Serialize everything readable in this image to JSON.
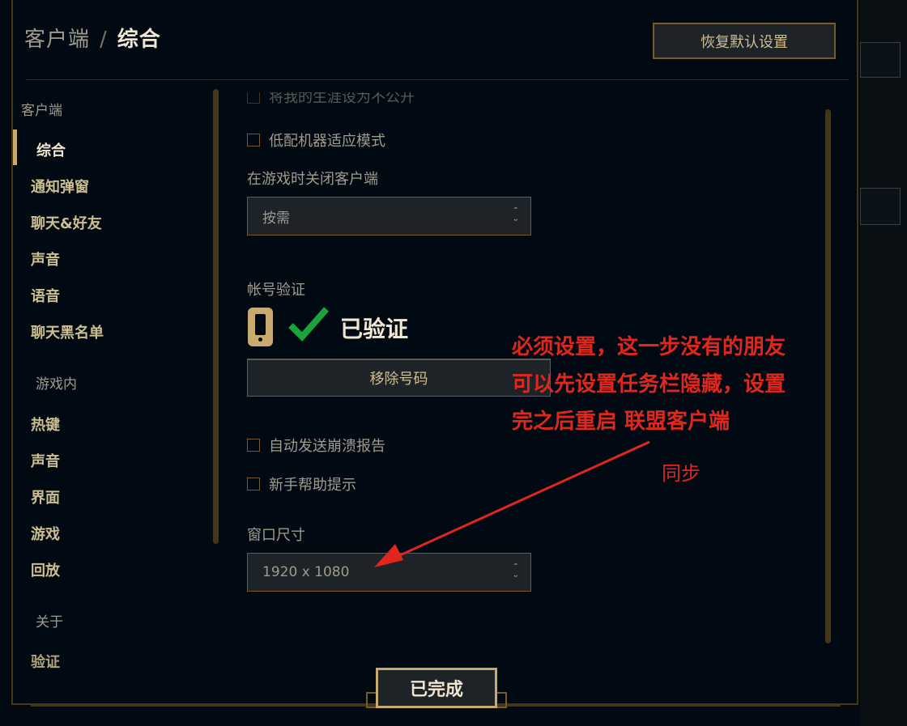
{
  "header": {
    "breadcrumb_parent": "客户端",
    "breadcrumb_separator": "/",
    "breadcrumb_current": "综合",
    "reset_button": "恢复默认设置"
  },
  "sidebar": {
    "cat_client": "客户端",
    "items_client": [
      "综合",
      "通知弹窗",
      "聊天&好友",
      "声音",
      "语音",
      "聊天黑名单"
    ],
    "cat_ingame": "游戏内",
    "items_ingame": [
      "热键",
      "声音",
      "界面",
      "游戏",
      "回放"
    ],
    "cat_about": "关于",
    "items_about": [
      "验证"
    ]
  },
  "content": {
    "cut_off_option": "将我的生涯设为不公开",
    "low_spec_mode": "低配机器适应模式",
    "close_client_label": "在游戏时关闭客户端",
    "close_client_value": "按需",
    "account_verify_label": "帐号验证",
    "verified_text": "已验证",
    "remove_number_button": "移除号码",
    "auto_crash_report": "自动发送崩溃报告",
    "newbie_tips": "新手帮助提示",
    "window_size_label": "窗口尺寸",
    "window_size_value": "1920 x 1080"
  },
  "annotation": {
    "line1": "必须设置，这一步没有的朋友",
    "line2": "可以先设置任务栏隐藏，设置",
    "line3": "完之后重启 联盟客户端",
    "sync": "同步"
  },
  "footer": {
    "done_button": "已完成"
  },
  "colors": {
    "gold": "#c8aa6e",
    "dark_gold": "#785a28",
    "bg": "#010a13",
    "annotation_red": "#e0271d",
    "check_green": "#1aa33a"
  },
  "icons": [
    "phone-icon",
    "check-icon",
    "chevron-updown-icon",
    "arrow-annotation"
  ]
}
